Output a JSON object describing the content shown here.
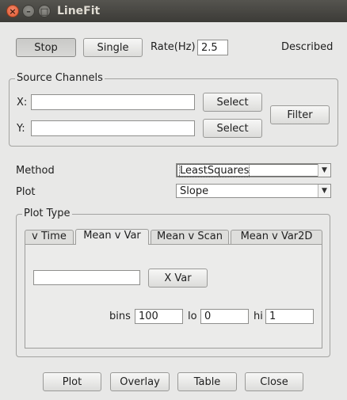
{
  "window": {
    "title": "LineFit",
    "close_glyph": "×",
    "min_glyph": "–",
    "max_glyph": "□"
  },
  "toolbar": {
    "stop_label": "Stop",
    "single_label": "Single",
    "rate_label": "Rate(Hz)",
    "rate_value": "2.5",
    "status_text": "Described"
  },
  "source_channels": {
    "title": "Source Channels",
    "x_label": "X:",
    "x_value": "",
    "y_label": "Y:",
    "y_value": "",
    "x_select_label": "Select",
    "y_select_label": "Select",
    "filter_label": "Filter"
  },
  "settings": {
    "method_label": "Method",
    "method_value": "LeastSquares",
    "plot_label": "Plot",
    "plot_value": "Slope",
    "arrow_glyph": "▼"
  },
  "plot_type": {
    "title": "Plot Type",
    "tabs": [
      {
        "label": "v Time",
        "active": false
      },
      {
        "label": "Mean v Var",
        "active": true
      },
      {
        "label": "Mean v Scan",
        "active": false
      },
      {
        "label": "Mean v Var2D",
        "active": false
      }
    ],
    "xvar_value": "",
    "xvar_button_label": "X Var",
    "bins_label": "bins",
    "bins_value": "100",
    "lo_label": "lo",
    "lo_value": "0",
    "hi_label": "hi",
    "hi_value": "1"
  },
  "footer": {
    "plot_label": "Plot",
    "overlay_label": "Overlay",
    "table_label": "Table",
    "close_label": "Close"
  }
}
